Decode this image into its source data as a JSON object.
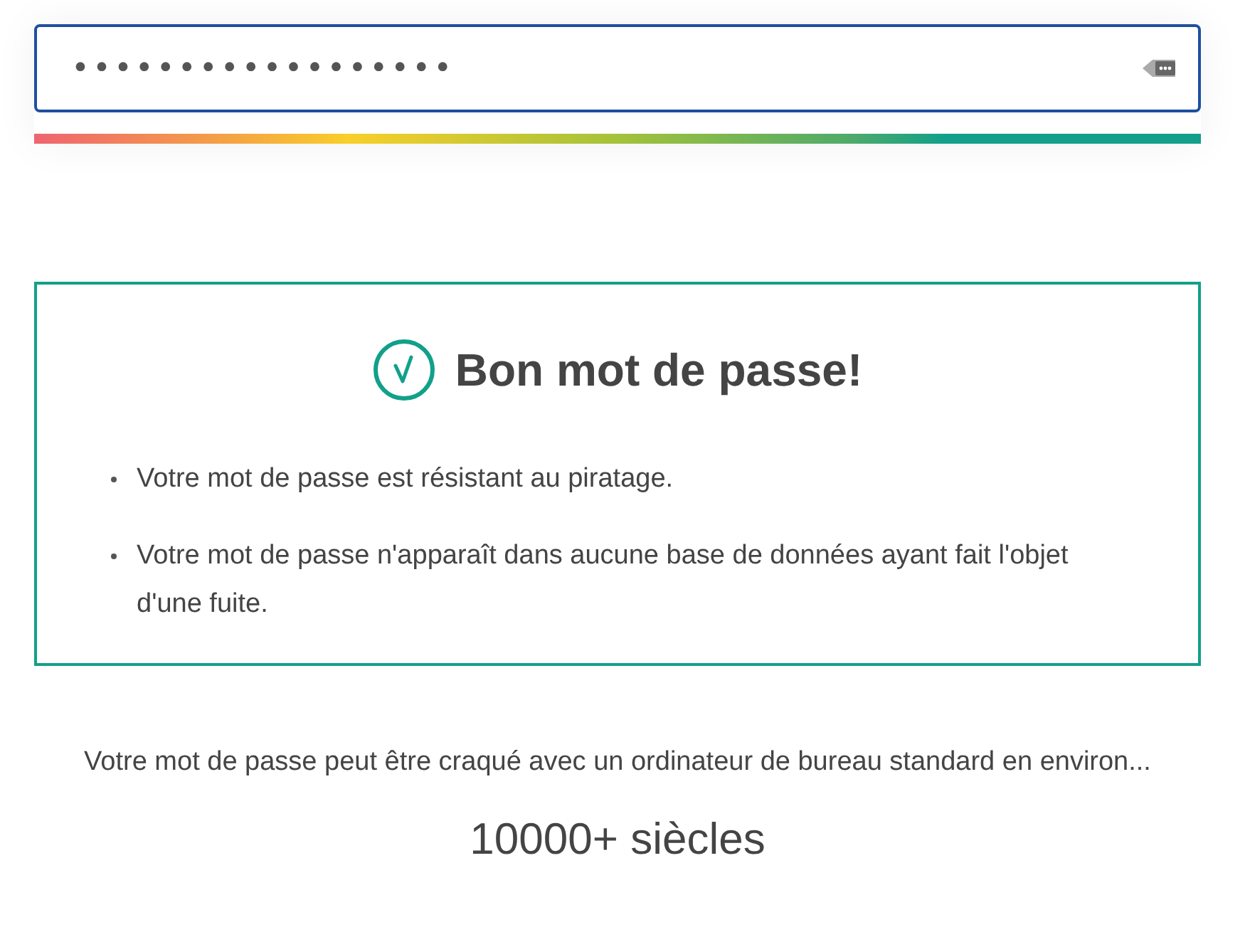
{
  "password_field": {
    "value": "••••••••••••••••••"
  },
  "strength_meter": {
    "level": 1
  },
  "result": {
    "title": "Bon mot de passe!",
    "points": [
      "Votre mot de passe est résistant au piratage.",
      "Votre mot de passe n'apparaît dans aucune base de données ayant fait l'objet d'une fuite."
    ]
  },
  "estimate": {
    "text": "Votre mot de passe peut être craqué avec un ordinateur de bureau standard en environ...",
    "time": "10000+ siècles"
  }
}
